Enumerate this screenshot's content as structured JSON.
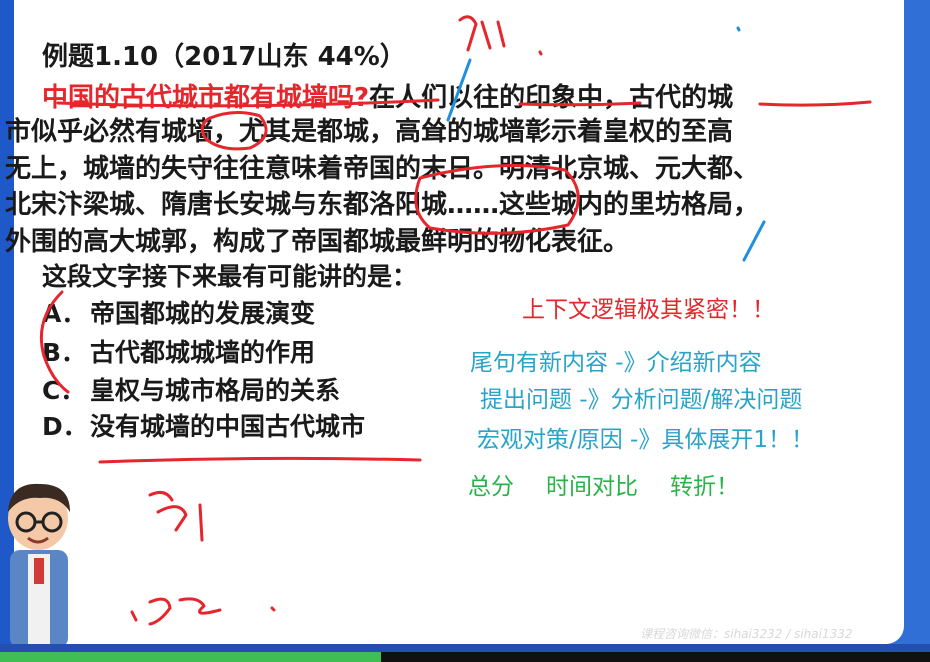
{
  "slide": {
    "title": "例题1.10（2017山东 44%）",
    "question": "中国的古代城市都有城墙吗?",
    "p1_rest": "在人们以往的印象中，古代的城",
    "p2": "市似乎必然有城墙，尤其是都城，高耸的城墙彰示着皇权的至高",
    "p3": "无上，城墙的失守往往意味着帝国的末日。明清北京城、元大都、",
    "p4": "北宋汴梁城、隋唐长安城与东都洛阳城……这些城内的里坊格局，",
    "p5": "外围的高大城郭，构成了帝国都城最鲜明的物化表征。",
    "prompt": "这段文字接下来最有可能讲的是：",
    "options": [
      {
        "letter": "A．",
        "text": "帝国都城的发展演变"
      },
      {
        "letter": "B．",
        "text": "古代都城城墙的作用"
      },
      {
        "letter": "C．",
        "text": "皇权与城市格局的关系"
      },
      {
        "letter": "D．",
        "text": "没有城墙的中国古代城市"
      }
    ]
  },
  "notes": {
    "red": "上下文逻辑极其紧密！！",
    "blue1": "尾句有新内容 -》介绍新内容",
    "blue2": "提出问题 -》分析问题/解决问题",
    "blue3": "宏观对策/原因 -》具体展开1！！",
    "green": [
      "总分",
      "时间对比",
      "转折！"
    ]
  },
  "watermark": "课程咨询微信：sihai3232 / sihai1332",
  "colors": {
    "frame": "#2f6fd6",
    "ink_red": "#e6262d",
    "ink_blue": "#28a4c8",
    "ink_green": "#2bb34a"
  },
  "video_progress": 0.41
}
